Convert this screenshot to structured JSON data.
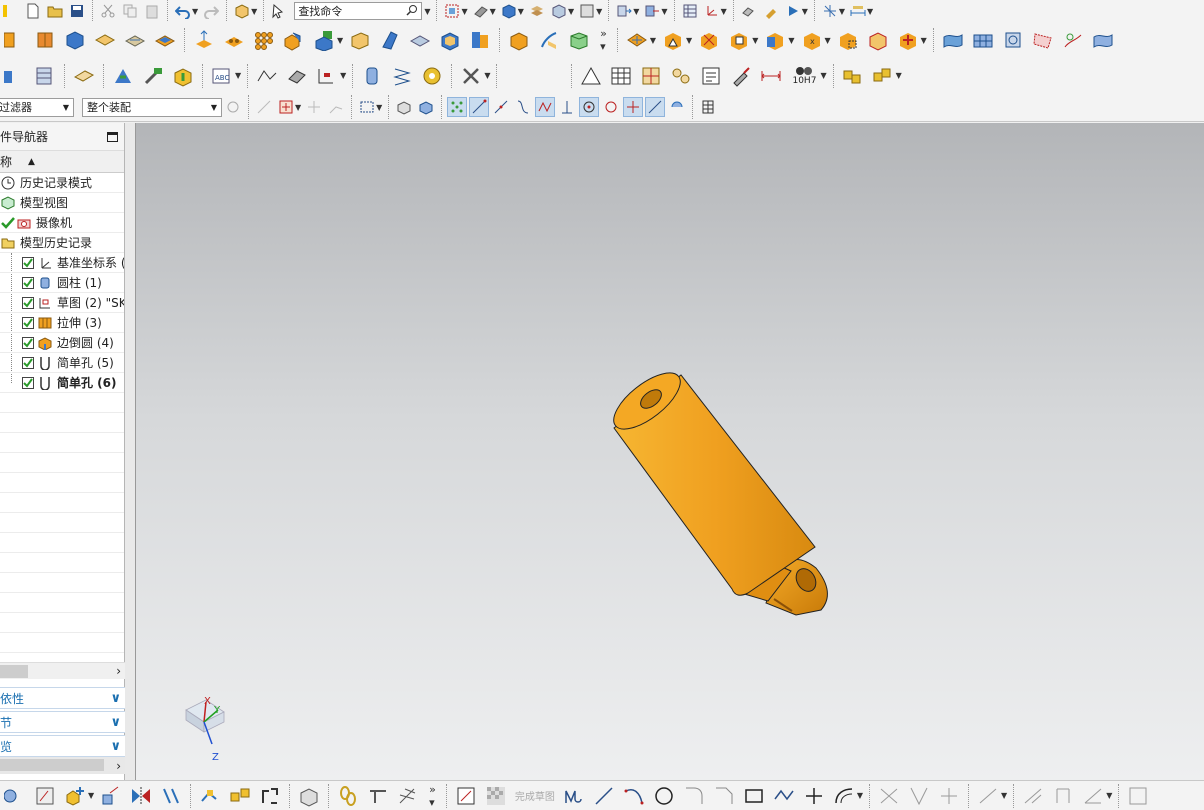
{
  "toolbar": {
    "find_command_placeholder": "查找命令",
    "filter_select": "过滤器",
    "assembly_select": "整个装配",
    "dim_label": "10H7"
  },
  "navigator": {
    "title": "件导航器",
    "column_name": "称",
    "items": [
      {
        "label": "历史记录模式",
        "icon": "clock-icon"
      },
      {
        "label": "模型视图",
        "icon": "model-views-icon"
      },
      {
        "label": "摄像机",
        "icon": "camera-icon"
      },
      {
        "label": "模型历史记录",
        "icon": "folder-icon"
      },
      {
        "label": "基准坐标系 (",
        "icon": "datum-csys-icon",
        "checked": true
      },
      {
        "label": "圆柱 (1)",
        "icon": "cylinder-icon",
        "checked": true
      },
      {
        "label": "草图 (2) \"SK",
        "icon": "sketch-icon",
        "checked": true
      },
      {
        "label": "拉伸 (3)",
        "icon": "extrude-icon",
        "checked": true
      },
      {
        "label": "边倒圆 (4)",
        "icon": "edge-blend-icon",
        "checked": true
      },
      {
        "label": "简单孔 (5)",
        "icon": "hole-icon",
        "checked": true
      },
      {
        "label": "简单孔 (6)",
        "icon": "hole-icon",
        "checked": true,
        "bold": true
      }
    ]
  },
  "panels": {
    "dependencies": "依性",
    "details": "节",
    "preview": "览"
  },
  "bottom_toolbar": {
    "finish_sketch": "完成草图"
  },
  "triad": {
    "x": "X",
    "y": "Y",
    "z": "Z"
  },
  "colors": {
    "part_orange": "#f0a020",
    "part_orange_dark": "#c87a08",
    "viewport_top": "#b3b5b8",
    "viewport_bottom": "#eeeff0",
    "panel_blue": "#1a6fb0"
  }
}
